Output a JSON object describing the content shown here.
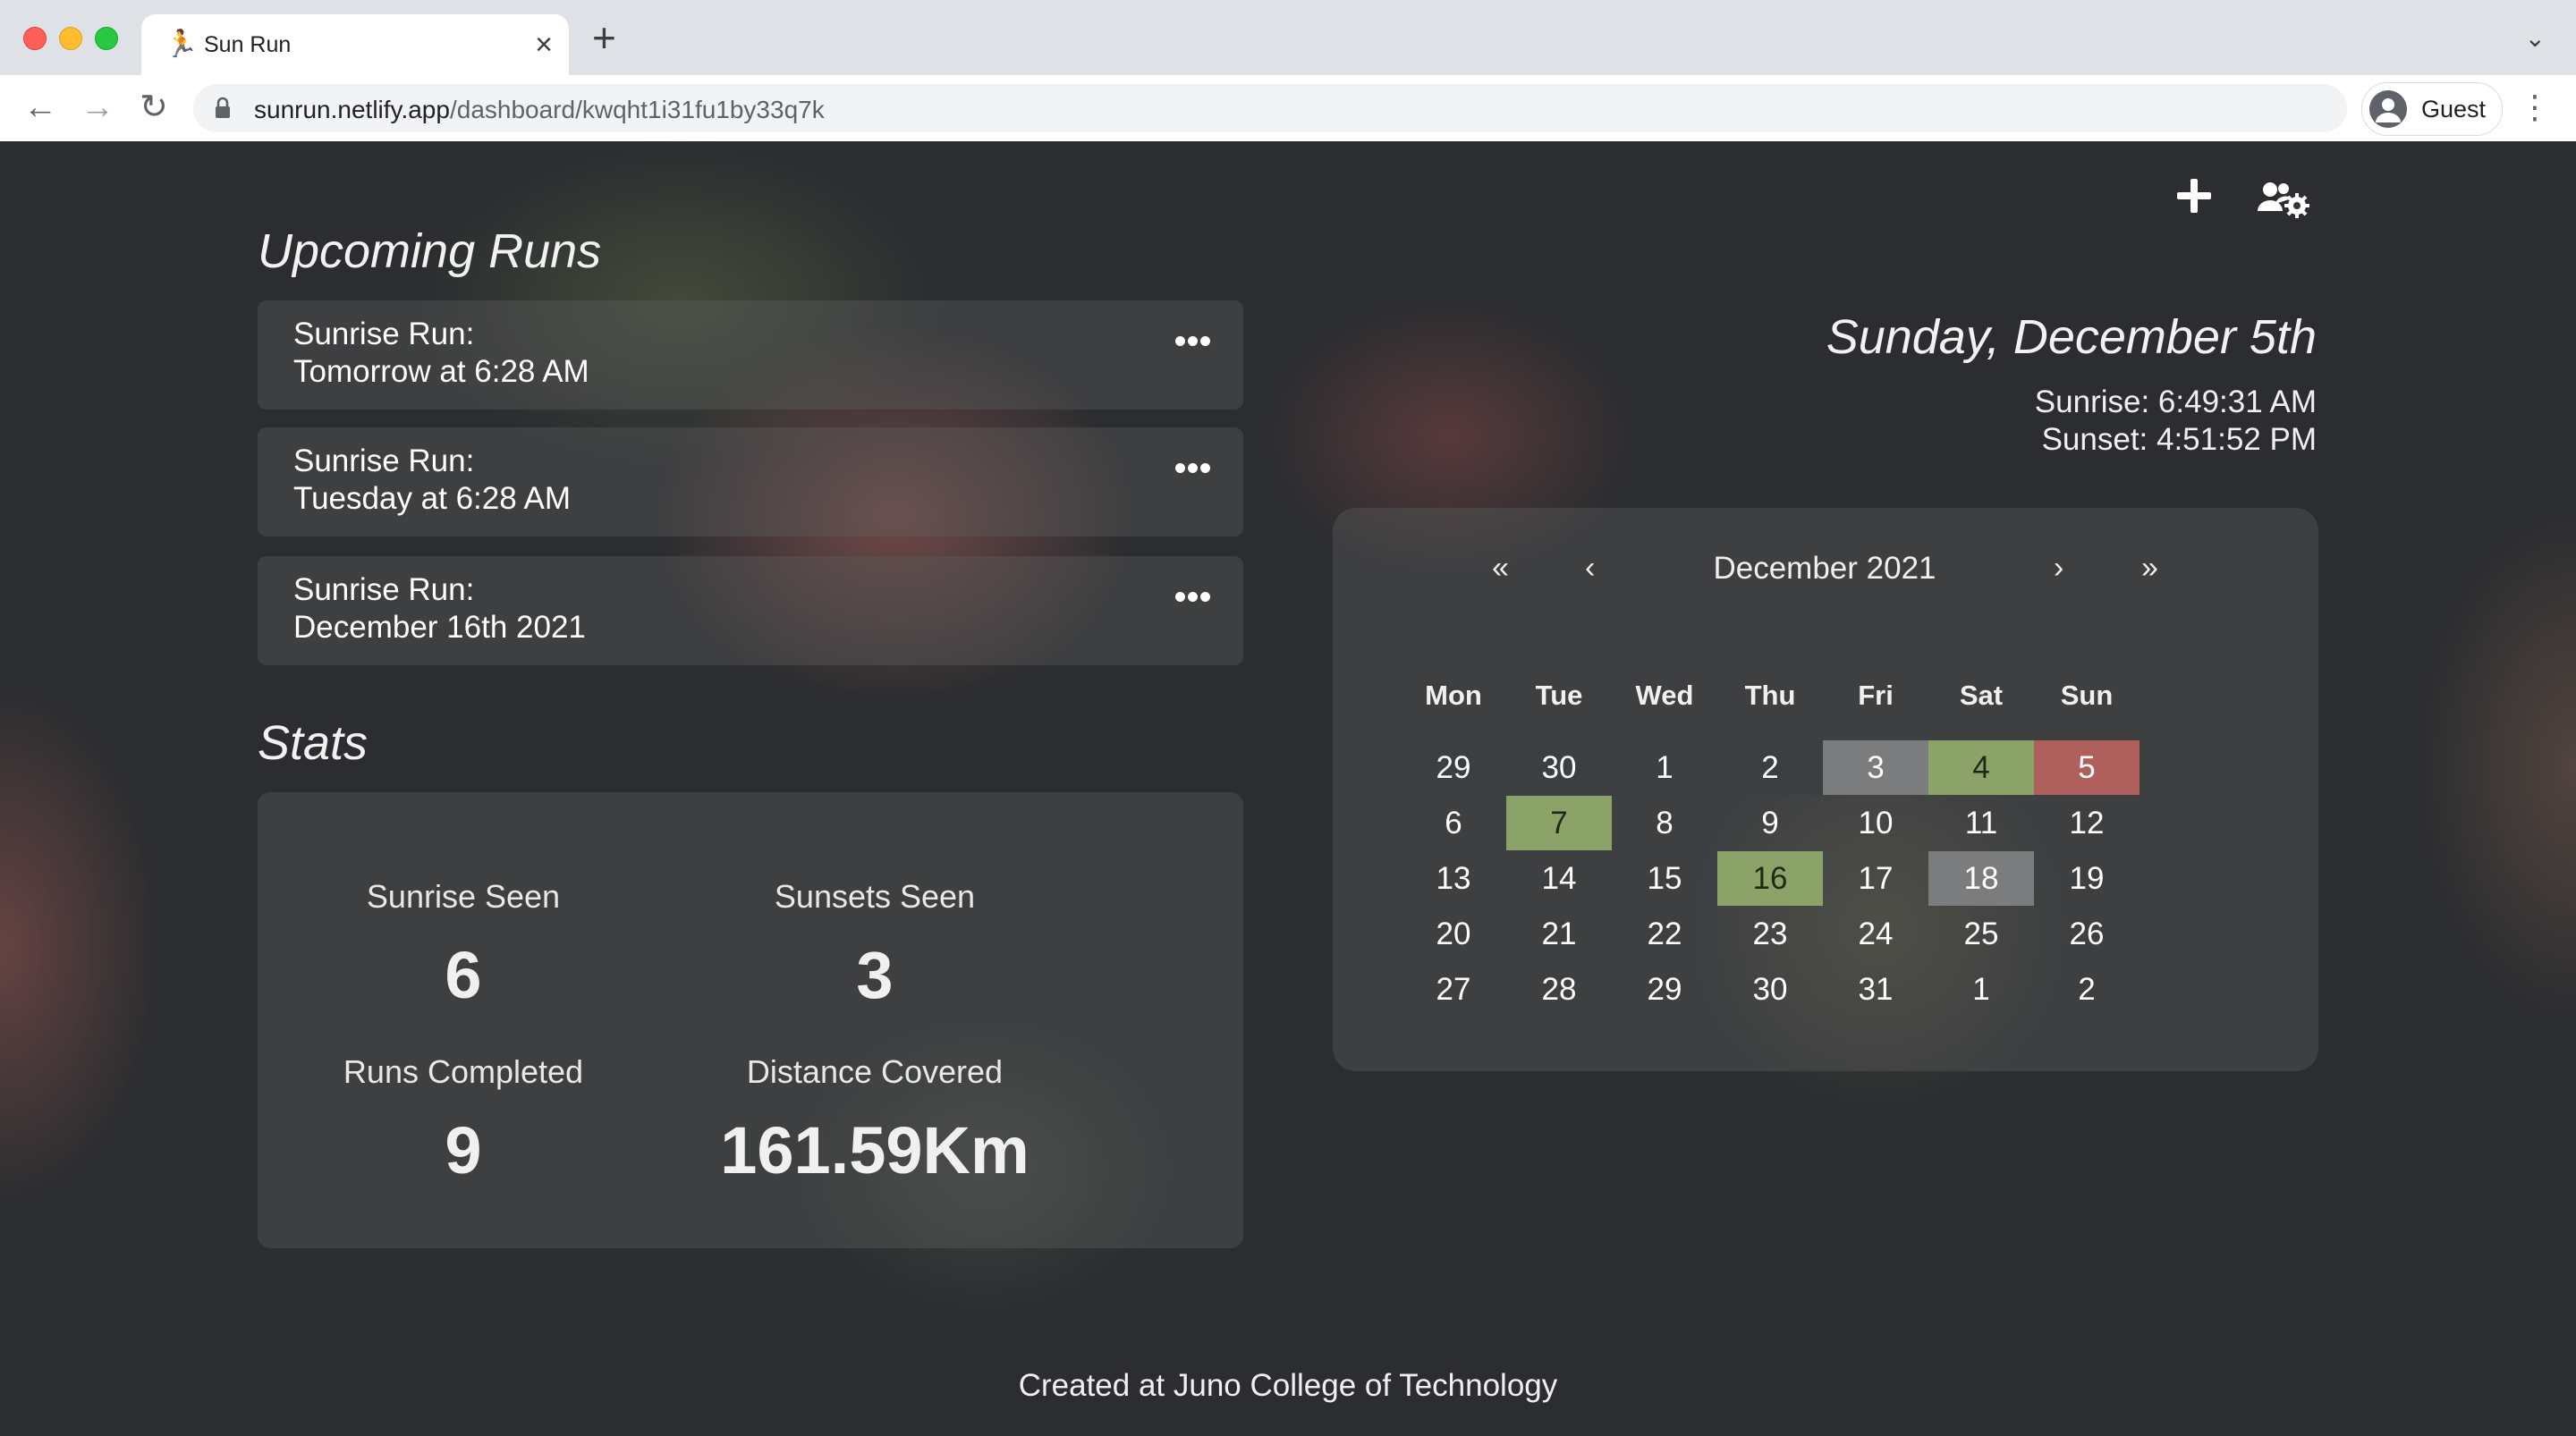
{
  "browser": {
    "tab_title": "Sun Run",
    "tab_favicon": "🏃",
    "url_domain": "sunrun.netlify.app",
    "url_path": "/dashboard/kwqht1i31fu1by33q7k",
    "profile_label": "Guest"
  },
  "upcoming": {
    "title": "Upcoming Runs",
    "runs": [
      {
        "line1": "Sunrise Run:",
        "line2": "Tomorrow at 6:28 AM"
      },
      {
        "line1": "Sunrise Run:",
        "line2": "Tuesday at 6:28 AM"
      },
      {
        "line1": "Sunrise Run:",
        "line2": "December 16th 2021"
      }
    ]
  },
  "stats": {
    "title": "Stats",
    "items": [
      {
        "label": "Sunrise Seen",
        "value": "6"
      },
      {
        "label": "Sunsets Seen",
        "value": "3"
      },
      {
        "label": "Runs Completed",
        "value": "9"
      },
      {
        "label": "Distance Covered",
        "value": "161.59Km"
      }
    ]
  },
  "today": {
    "date": "Sunday, December 5th",
    "sunrise": "Sunrise: 6:49:31 AM",
    "sunset": "Sunset: 4:51:52 PM"
  },
  "calendar": {
    "prev_year": "«",
    "prev_month": "‹",
    "month_label": "December 2021",
    "next_month": "›",
    "next_year": "»",
    "weekdays": [
      "Mon",
      "Tue",
      "Wed",
      "Thu",
      "Fri",
      "Sat",
      "Sun"
    ],
    "colors": {
      "gray": "#7a7c7e",
      "green": "#8ba368",
      "red": "#b0605c",
      "dimrow": "#3c3f42"
    },
    "weeks": [
      [
        {
          "d": "29",
          "s": "dim"
        },
        {
          "d": "30",
          "s": "dim"
        },
        {
          "d": "1",
          "s": "dim"
        },
        {
          "d": "2",
          "s": "dim"
        },
        {
          "d": "3",
          "s": "gray"
        },
        {
          "d": "4",
          "s": "green"
        },
        {
          "d": "5",
          "s": "red"
        }
      ],
      [
        {
          "d": "6",
          "s": ""
        },
        {
          "d": "7",
          "s": "green"
        },
        {
          "d": "8",
          "s": ""
        },
        {
          "d": "9",
          "s": ""
        },
        {
          "d": "10",
          "s": ""
        },
        {
          "d": "11",
          "s": ""
        },
        {
          "d": "12",
          "s": ""
        }
      ],
      [
        {
          "d": "13",
          "s": ""
        },
        {
          "d": "14",
          "s": ""
        },
        {
          "d": "15",
          "s": ""
        },
        {
          "d": "16",
          "s": "green"
        },
        {
          "d": "17",
          "s": ""
        },
        {
          "d": "18",
          "s": "gray"
        },
        {
          "d": "19",
          "s": ""
        }
      ],
      [
        {
          "d": "20",
          "s": ""
        },
        {
          "d": "21",
          "s": ""
        },
        {
          "d": "22",
          "s": ""
        },
        {
          "d": "23",
          "s": ""
        },
        {
          "d": "24",
          "s": ""
        },
        {
          "d": "25",
          "s": ""
        },
        {
          "d": "26",
          "s": ""
        }
      ],
      [
        {
          "d": "27",
          "s": ""
        },
        {
          "d": "28",
          "s": ""
        },
        {
          "d": "29",
          "s": ""
        },
        {
          "d": "30",
          "s": ""
        },
        {
          "d": "31",
          "s": ""
        },
        {
          "d": "1",
          "s": ""
        },
        {
          "d": "2",
          "s": ""
        }
      ]
    ]
  },
  "footer": {
    "text": "Created at Juno College of Technology"
  }
}
